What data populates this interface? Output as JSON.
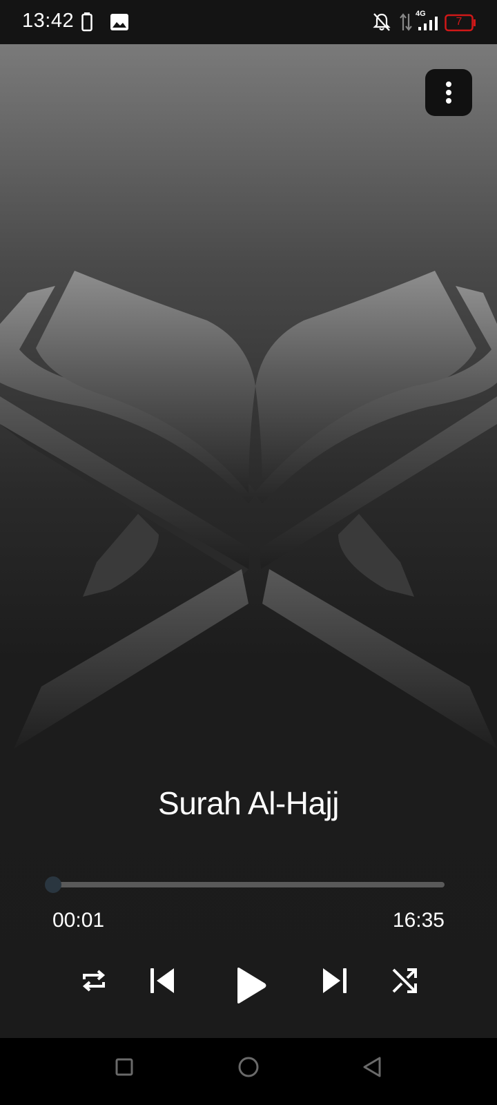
{
  "status_bar": {
    "time": "13:42",
    "network_label": "4G",
    "battery_level": "7",
    "icons": [
      "battery-saver-icon",
      "image-notification-icon",
      "notifications-off-icon",
      "data-transfer-icon",
      "signal-icon",
      "battery-icon"
    ],
    "battery_color": "#d01818"
  },
  "player": {
    "title": "Surah Al-Hajj",
    "elapsed": "00:01",
    "duration": "16:35",
    "progress_fraction": 0.001,
    "menu_icon": "more-vertical-icon",
    "artwork_icon": "quran-book-icon",
    "controls": [
      "repeat-icon",
      "skip-previous-icon",
      "play-icon",
      "skip-next-icon",
      "shuffle-icon"
    ],
    "accent_color": "#2a3640"
  },
  "nav_bar": {
    "icons": [
      "recents-square-icon",
      "home-circle-icon",
      "back-triangle-icon"
    ]
  }
}
